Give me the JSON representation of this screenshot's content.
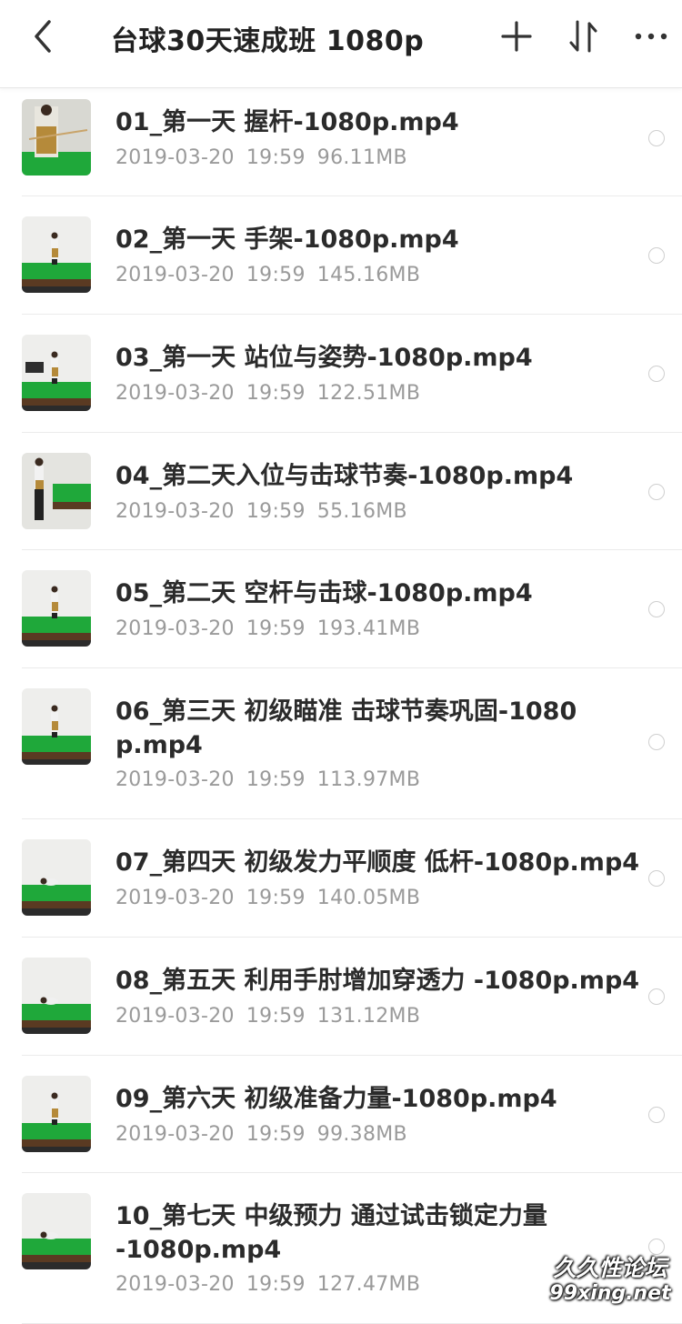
{
  "header": {
    "title": "台球30天速成班  1080p",
    "icons": [
      "chevron-left-icon",
      "plus-icon",
      "sort-icon",
      "more-icon"
    ]
  },
  "files": [
    {
      "name": "01_第一天 握杆-1080p.mp4",
      "date": "2019-03-20",
      "time": "19:59",
      "size": "96.11MB"
    },
    {
      "name": "02_第一天 手架-1080p.mp4",
      "date": "2019-03-20",
      "time": "19:59",
      "size": "145.16MB"
    },
    {
      "name": "03_第一天 站位与姿势-1080p.mp4",
      "date": "2019-03-20",
      "time": "19:59",
      "size": "122.51MB"
    },
    {
      "name": "04_第二天入位与击球节奏-1080p.mp4",
      "date": "2019-03-20",
      "time": "19:59",
      "size": "55.16MB"
    },
    {
      "name": "05_第二天 空杆与击球-1080p.mp4",
      "date": "2019-03-20",
      "time": "19:59",
      "size": "193.41MB"
    },
    {
      "name": "06_第三天 初级瞄准 击球节奏巩固-1080p.mp4",
      "date": "2019-03-20",
      "time": "19:59",
      "size": "113.97MB"
    },
    {
      "name": "07_第四天 初级发力平顺度 低杆-1080p.mp4",
      "date": "2019-03-20",
      "time": "19:59",
      "size": "140.05MB"
    },
    {
      "name": "08_第五天 利用手肘增加穿透力 -1080p.mp4",
      "date": "2019-03-20",
      "time": "19:59",
      "size": "131.12MB"
    },
    {
      "name": "09_第六天 初级准备力量-1080p.mp4",
      "date": "2019-03-20",
      "time": "19:59",
      "size": "99.38MB"
    },
    {
      "name": "10_第七天 中级预力 通过试击锁定力量-1080p.mp4",
      "date": "2019-03-20",
      "time": "19:59",
      "size": "127.47MB"
    }
  ],
  "watermark": {
    "line1": "久久性论坛",
    "line2": "99xing.net"
  },
  "colors": {
    "table_green": "#1fa83a",
    "text": "#2b2b2b",
    "meta": "#9a9a9a"
  }
}
